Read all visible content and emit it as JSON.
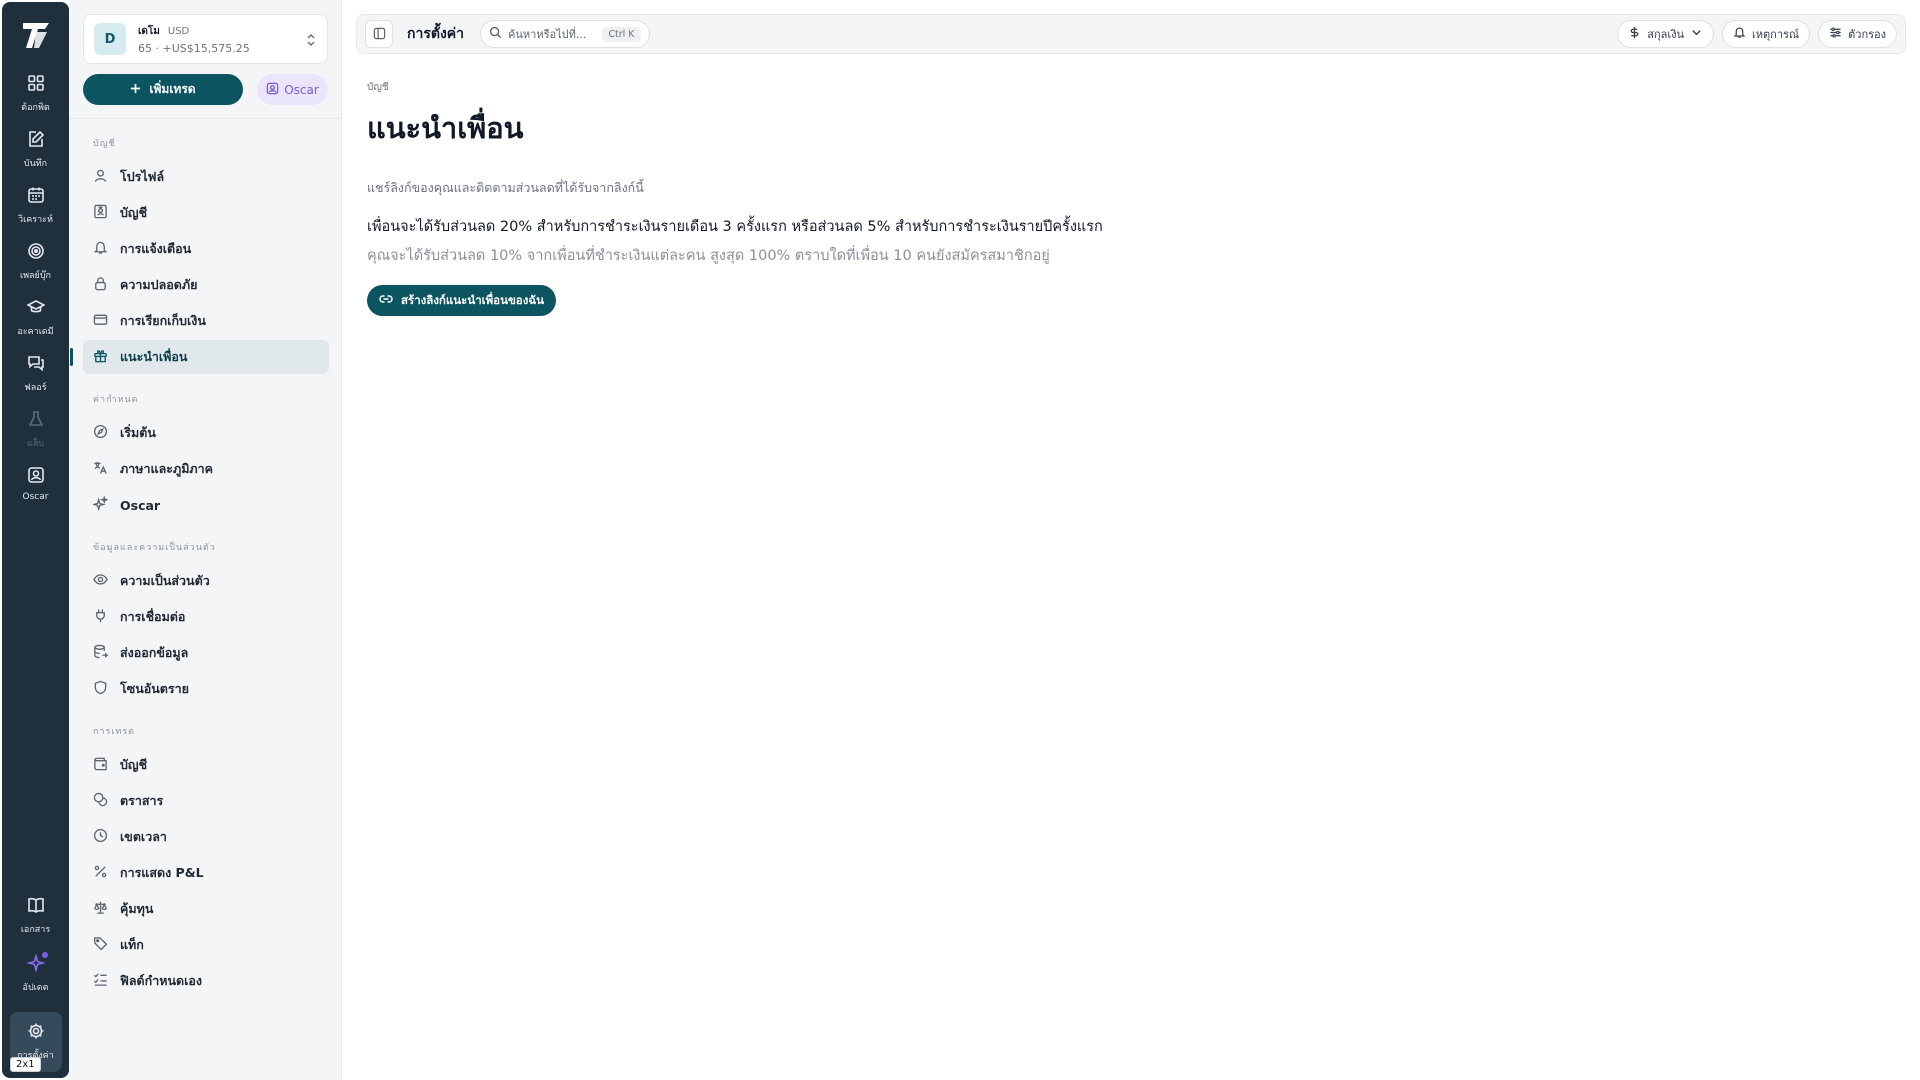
{
  "rail": {
    "items": [
      {
        "label": "ต้อกพิต",
        "icon": "dashboard-icon"
      },
      {
        "label": "บันทึก",
        "icon": "journal-icon"
      },
      {
        "label": "วิเคราะห์",
        "icon": "calendar-icon"
      },
      {
        "label": "เพลย์บุ๊ก",
        "icon": "target-icon"
      },
      {
        "label": "อะคาเดมี",
        "icon": "academy-icon"
      },
      {
        "label": "ฟลอร์",
        "icon": "chat-icon"
      },
      {
        "label": "แล็บ",
        "icon": "flask-icon"
      },
      {
        "label": "Oscar",
        "icon": "oscar-icon"
      }
    ],
    "bottom": [
      {
        "label": "เอกสาร",
        "icon": "book-icon"
      },
      {
        "label": "อัปเดต",
        "icon": "sparkle-icon"
      }
    ],
    "settings_label": "การตั้งค่า",
    "zoom_badge": "2x1"
  },
  "account": {
    "avatar": "D",
    "name": "เดโม",
    "currency": "USD",
    "summary": "65 · +US$15,575.25"
  },
  "sidebar": {
    "add_trade": "เพิ่มเทรด",
    "oscar_label": "Oscar",
    "sections": [
      {
        "title": "บัญชี",
        "items": [
          "โปรไฟล์",
          "บัญชี",
          "การแจ้งเตือน",
          "ความปลอดภัย",
          "การเรียกเก็บเงิน",
          "แนะนำเพื่อน"
        ]
      },
      {
        "title": "ค่ากำหนด",
        "items": [
          "เริ่มต้น",
          "ภาษาและภูมิภาค",
          "Oscar"
        ]
      },
      {
        "title": "ข้อมูลและความเป็นส่วนตัว",
        "items": [
          "ความเป็นส่วนตัว",
          "การเชื่อมต่อ",
          "ส่งออกข้อมูล",
          "โซนอันตราย"
        ]
      },
      {
        "title": "การเทรด",
        "items": [
          "บัญชี",
          "ตราสาร",
          "เขตเวลา",
          "การแสดง P&L",
          "คุ้มทุน",
          "แท็ก",
          "ฟิลด์กำหนดเอง"
        ]
      }
    ]
  },
  "topbar": {
    "title": "การตั้งค่า",
    "search_placeholder": "ค้นหาหรือไปที่...",
    "search_shortcut": "Ctrl K",
    "currency_btn": "สกุลเงิน",
    "events_btn": "เหตุการณ์",
    "filter_btn": "ตัวกรอง"
  },
  "main": {
    "breadcrumb": "บัญชี",
    "title": "แนะนำเพื่อน",
    "subtitle": "แชร์ลิงก์ของคุณและติดตามส่วนลดที่ได้รับจากลิงก์นี้",
    "headline": "เพื่อนจะได้รับส่วนลด 20% สำหรับการชำระเงินรายเดือน 3 ครั้งแรก หรือส่วนลด 5% สำหรับการชำระเงินรายปีครั้งแรก",
    "detail": "คุณจะได้รับส่วนลด 10% จากเพื่อนที่ชำระเงินแต่ละคน สูงสุด 100% ตราบใดที่เพื่อน 10 คนยังสมัครสมาชิกอยู่",
    "cta": "สร้างลิงก์แนะนำเพื่อนของฉัน"
  },
  "colors": {
    "rail": "#1f2f3c",
    "accent": "#0c5560",
    "oscar": "#7b5cd6"
  }
}
